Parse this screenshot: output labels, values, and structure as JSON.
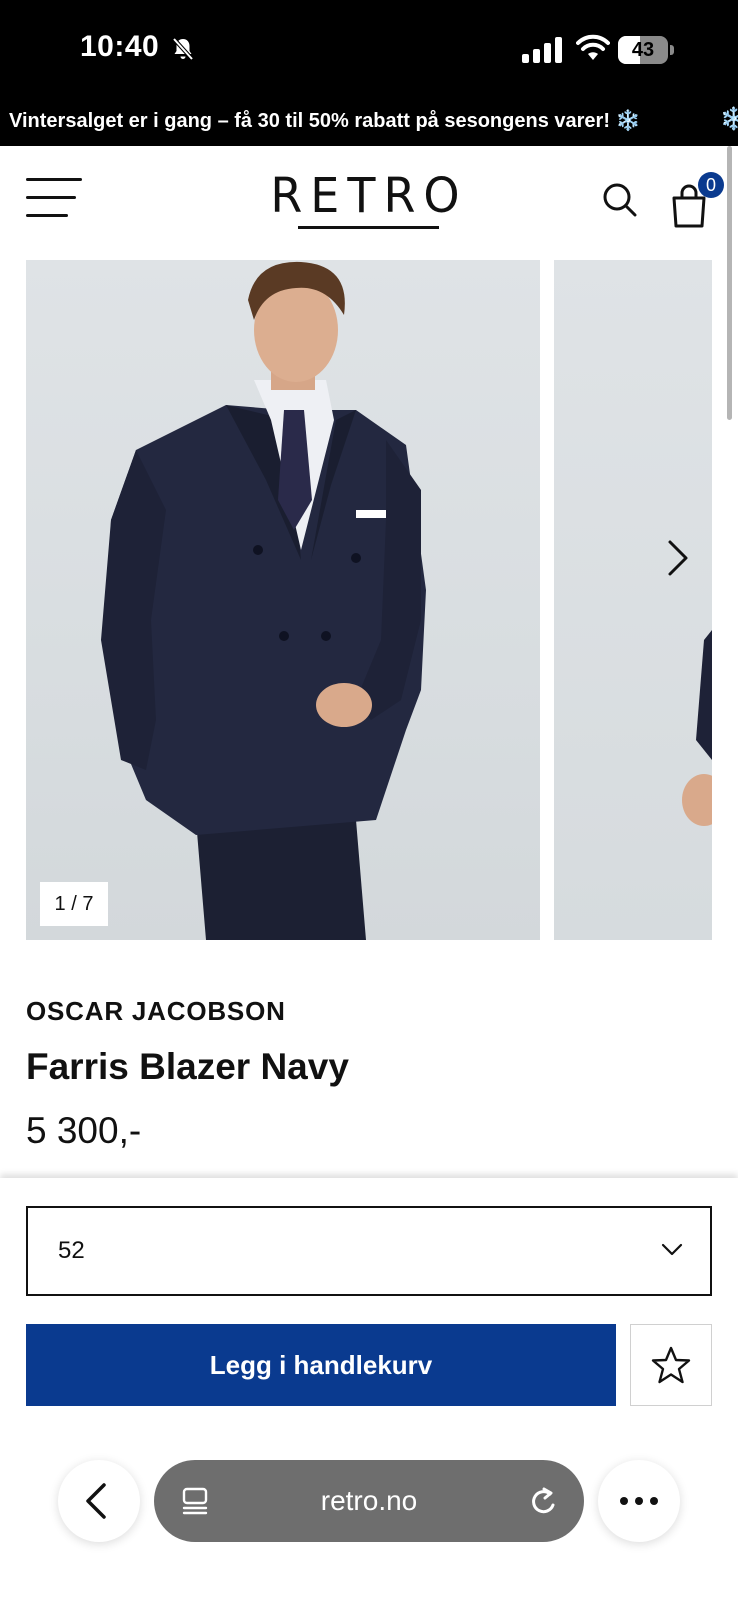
{
  "status_bar": {
    "time": "10:40",
    "battery_level": "43",
    "battery_fraction": 0.43,
    "icons": [
      "bell-slash-icon",
      "cellular-signal-icon",
      "wifi-icon",
      "battery-icon"
    ]
  },
  "announcement": {
    "text": "Vintersalget er i gang – få 30 til 50% rabatt på sesongens varer! ❄️",
    "repeat_glyph": "❄️"
  },
  "header": {
    "logo": "RETRO",
    "cart_count": "0",
    "icons": [
      "menu-icon",
      "search-icon",
      "shopping-bag-icon"
    ],
    "accent_color": "#0a3a8f"
  },
  "gallery": {
    "counter": "1 / 7",
    "current_image": 1,
    "total_images": 7,
    "image_description_icon": "product-photo"
  },
  "product": {
    "brand": "OSCAR JACOBSON",
    "name": "Farris Blazer Navy",
    "price": "5 300,-"
  },
  "purchase": {
    "size_selected": "52",
    "add_to_cart_label": "Legg i handlekurv",
    "button_color": "#0a3a8f",
    "wishlist_icon": "star-icon"
  },
  "browser": {
    "url": "retro.no",
    "icons": [
      "back-icon",
      "tabs-icon",
      "reload-icon",
      "more-icon"
    ]
  }
}
